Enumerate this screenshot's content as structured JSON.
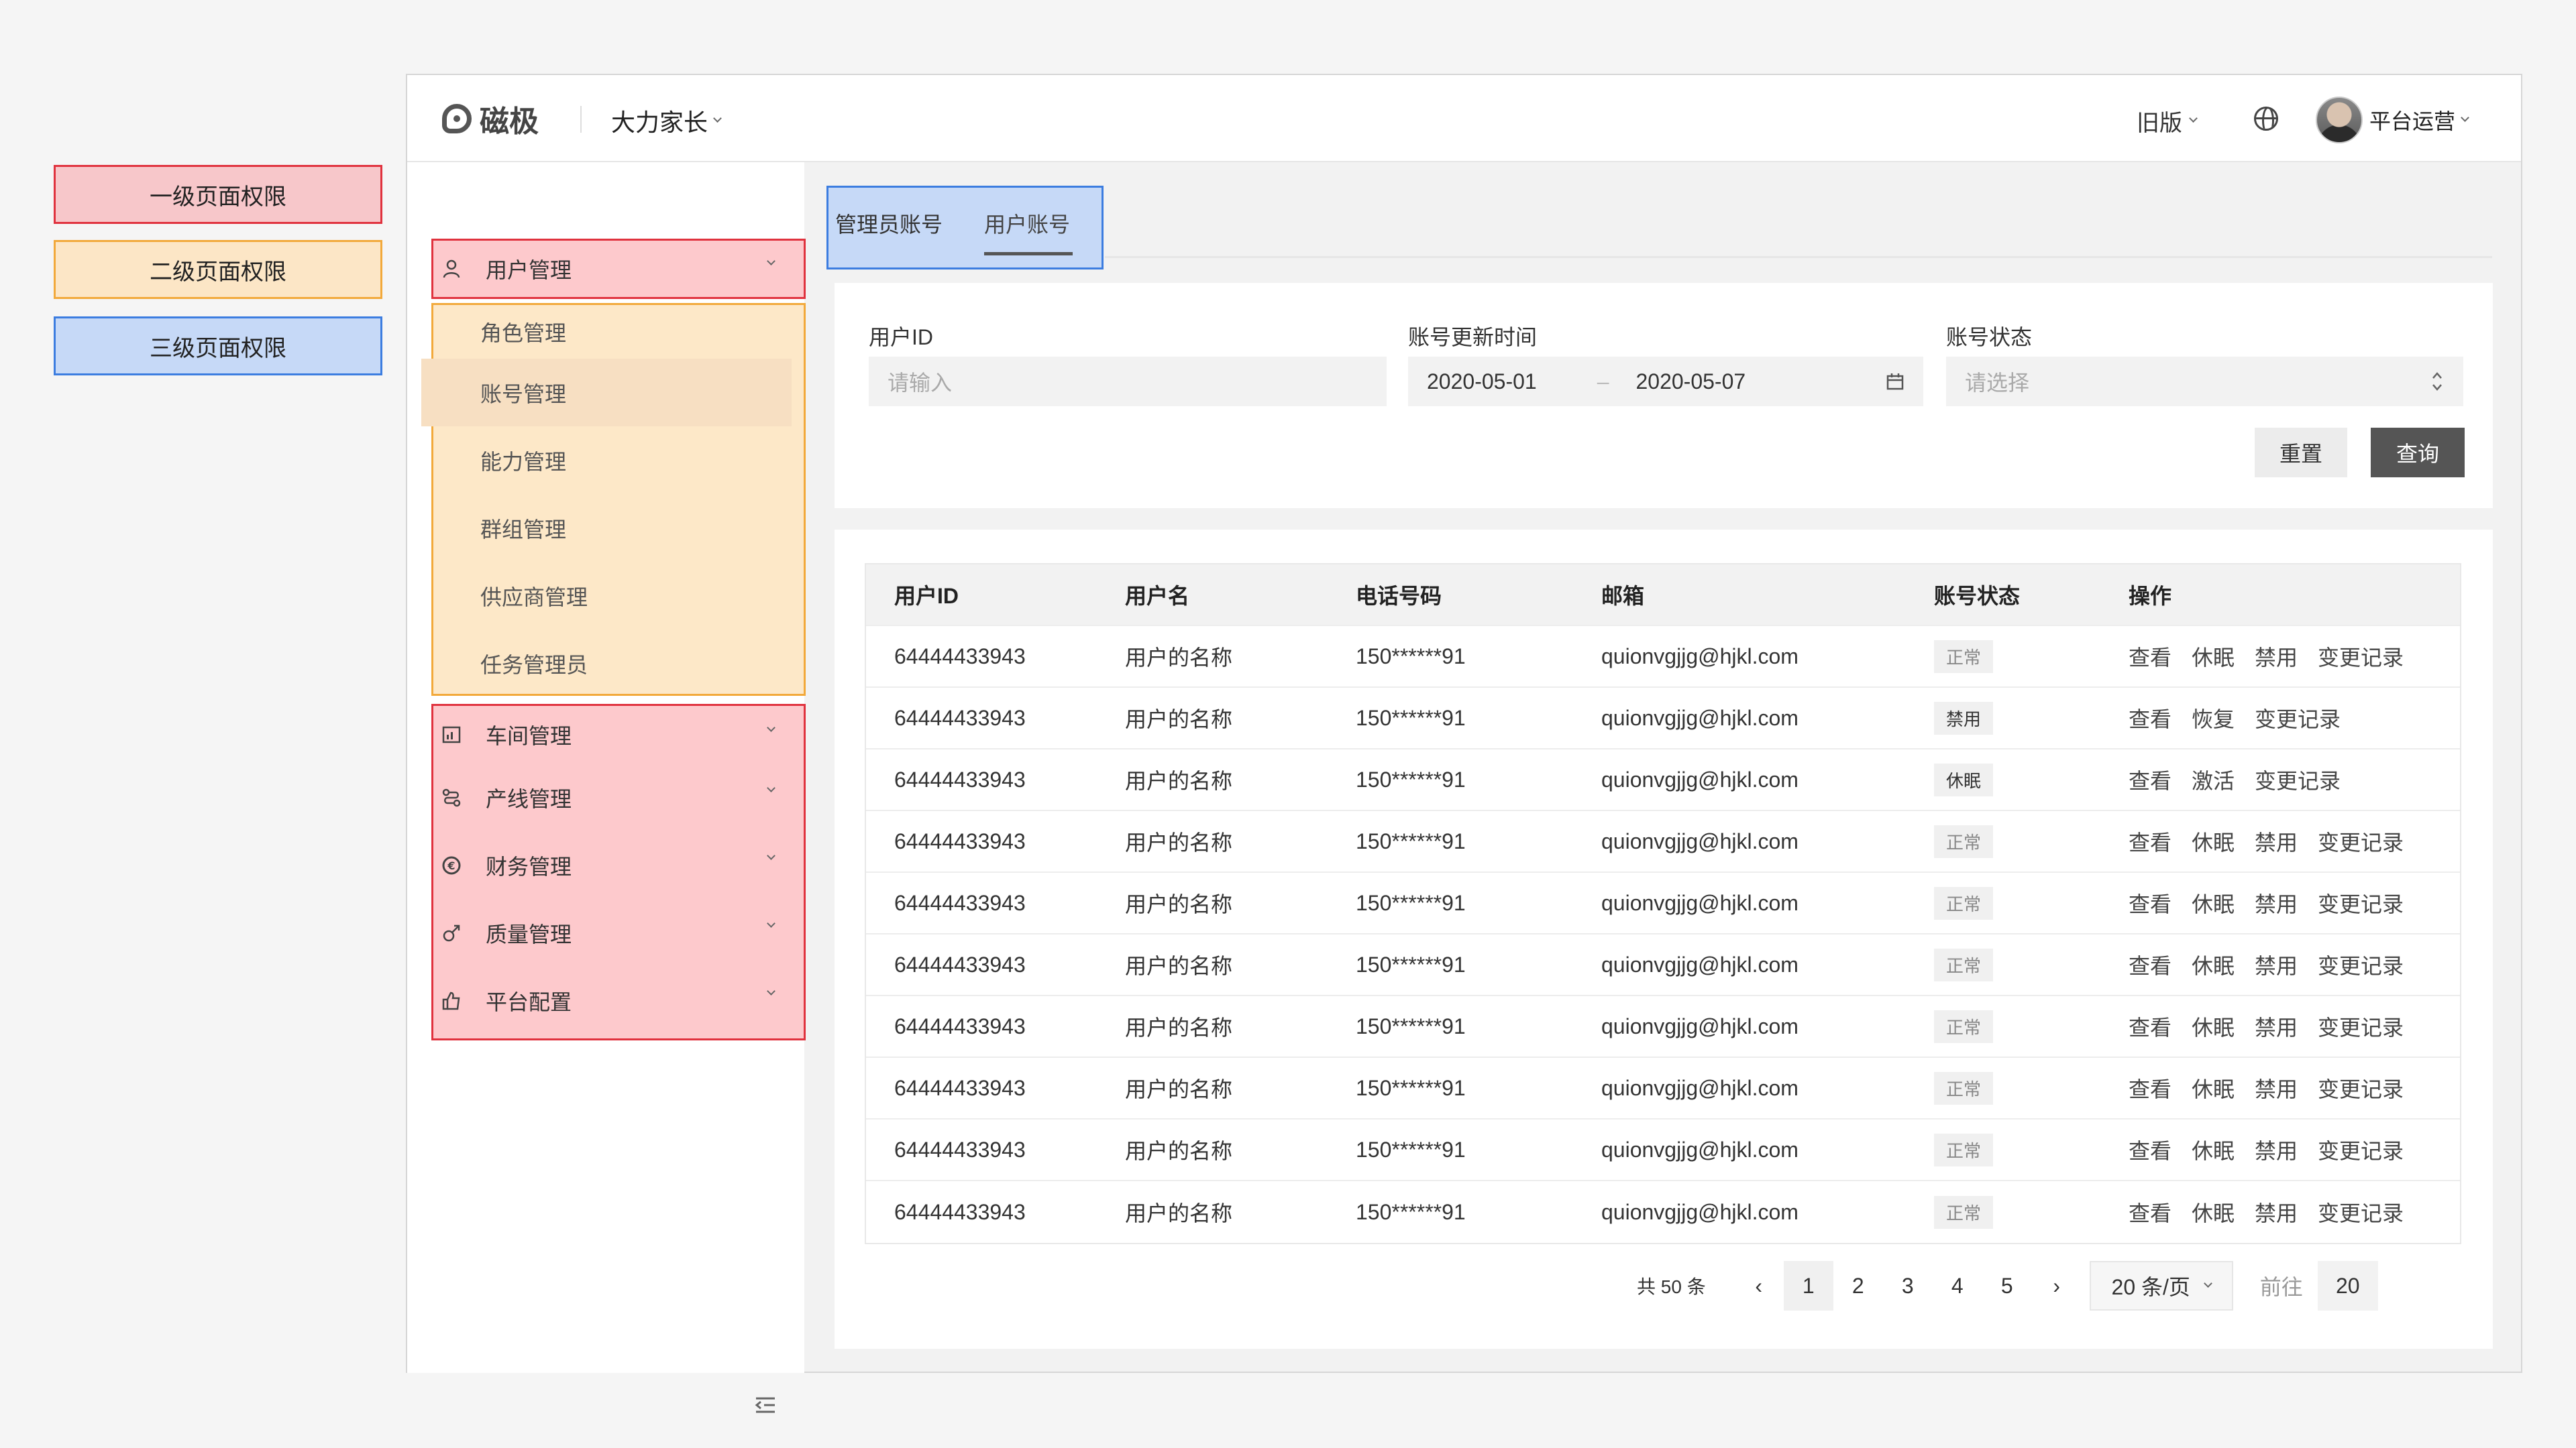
{
  "legend": {
    "level1": "一级页面权限",
    "level2": "二级页面权限",
    "level3": "三级页面权限"
  },
  "colors": {
    "level1_fill": "#fdc9cc",
    "level1_border": "#e0323e",
    "level2_fill": "#fde8c8",
    "level2_border": "#f2a93b",
    "level3_fill": "#c6d9f7",
    "level3_border": "#3c7de0",
    "primary_button": "#555555"
  },
  "header": {
    "logo": "磁极",
    "org": "大力家长",
    "old_version": "旧版",
    "user_name": "平台运营"
  },
  "sidebar": {
    "user_mgmt": "用户管理",
    "sub_items": [
      "角色管理",
      "账号管理",
      "能力管理",
      "群组管理",
      "供应商管理",
      "任务管理员"
    ],
    "items": [
      {
        "label": "车间管理",
        "icon": "chart-icon"
      },
      {
        "label": "产线管理",
        "icon": "flow-icon"
      },
      {
        "label": "财务管理",
        "icon": "currency-icon"
      },
      {
        "label": "质量管理",
        "icon": "gender-icon"
      },
      {
        "label": "平台配置",
        "icon": "thumb-icon"
      }
    ]
  },
  "tabs": {
    "admin": "管理员账号",
    "user": "用户账号"
  },
  "filter": {
    "user_id_label": "用户ID",
    "user_id_placeholder": "请输入",
    "time_label": "账号更新时间",
    "date_start": "2020-05-01",
    "date_sep": "–",
    "date_end": "2020-05-07",
    "status_label": "账号状态",
    "status_placeholder": "请选择",
    "reset": "重置",
    "query": "查询"
  },
  "table": {
    "headers": [
      "用户ID",
      "用户名",
      "电话号码",
      "邮箱",
      "账号状态",
      "操作"
    ],
    "rows": [
      {
        "id": "64444433943",
        "name": "用户的名称",
        "phone": "150******91",
        "email": "quionvgjjg@hjkl.com",
        "status": "正常",
        "ops": [
          "查看",
          "休眠",
          "禁用",
          "变更记录"
        ]
      },
      {
        "id": "64444433943",
        "name": "用户的名称",
        "phone": "150******91",
        "email": "quionvgjjg@hjkl.com",
        "status": "禁用",
        "ops": [
          "查看",
          "恢复",
          "变更记录"
        ]
      },
      {
        "id": "64444433943",
        "name": "用户的名称",
        "phone": "150******91",
        "email": "quionvgjjg@hjkl.com",
        "status": "休眠",
        "ops": [
          "查看",
          "激活",
          "变更记录"
        ]
      },
      {
        "id": "64444433943",
        "name": "用户的名称",
        "phone": "150******91",
        "email": "quionvgjjg@hjkl.com",
        "status": "正常",
        "ops": [
          "查看",
          "休眠",
          "禁用",
          "变更记录"
        ]
      },
      {
        "id": "64444433943",
        "name": "用户的名称",
        "phone": "150******91",
        "email": "quionvgjjg@hjkl.com",
        "status": "正常",
        "ops": [
          "查看",
          "休眠",
          "禁用",
          "变更记录"
        ]
      },
      {
        "id": "64444433943",
        "name": "用户的名称",
        "phone": "150******91",
        "email": "quionvgjjg@hjkl.com",
        "status": "正常",
        "ops": [
          "查看",
          "休眠",
          "禁用",
          "变更记录"
        ]
      },
      {
        "id": "64444433943",
        "name": "用户的名称",
        "phone": "150******91",
        "email": "quionvgjjg@hjkl.com",
        "status": "正常",
        "ops": [
          "查看",
          "休眠",
          "禁用",
          "变更记录"
        ]
      },
      {
        "id": "64444433943",
        "name": "用户的名称",
        "phone": "150******91",
        "email": "quionvgjjg@hjkl.com",
        "status": "正常",
        "ops": [
          "查看",
          "休眠",
          "禁用",
          "变更记录"
        ]
      },
      {
        "id": "64444433943",
        "name": "用户的名称",
        "phone": "150******91",
        "email": "quionvgjjg@hjkl.com",
        "status": "正常",
        "ops": [
          "查看",
          "休眠",
          "禁用",
          "变更记录"
        ]
      },
      {
        "id": "64444433943",
        "name": "用户的名称",
        "phone": "150******91",
        "email": "quionvgjjg@hjkl.com",
        "status": "正常",
        "ops": [
          "查看",
          "休眠",
          "禁用",
          "变更记录"
        ]
      }
    ]
  },
  "pagination": {
    "total": "共 50 条",
    "prev": "‹",
    "pages": [
      "1",
      "2",
      "3",
      "4",
      "5"
    ],
    "current": "1",
    "next": "›",
    "page_size": "20 条/页",
    "goto_label": "前往",
    "goto_value": "20"
  }
}
